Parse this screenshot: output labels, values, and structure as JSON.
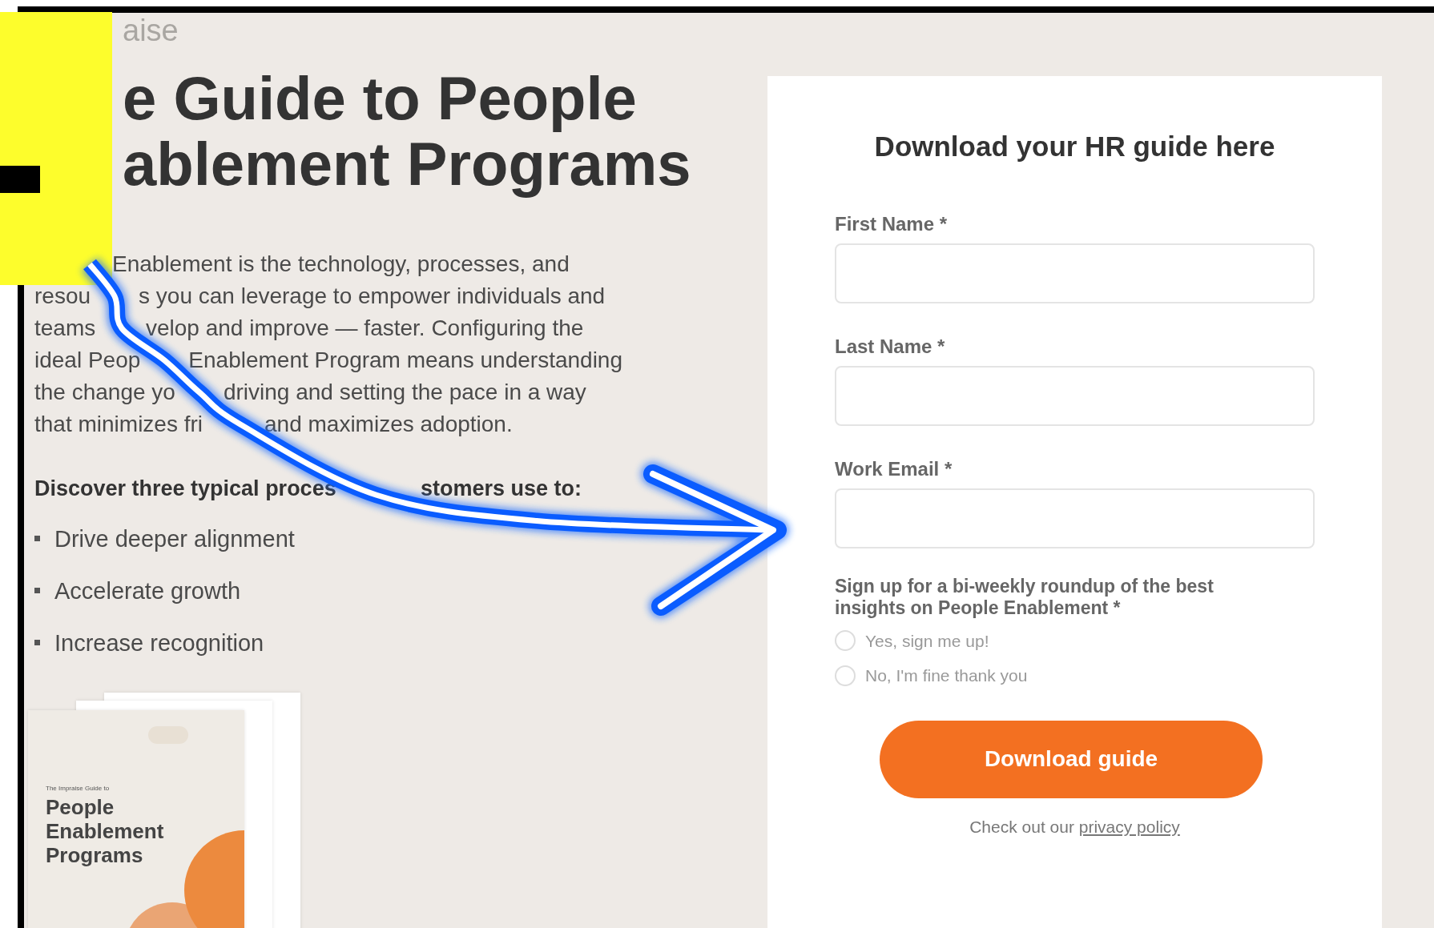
{
  "logo": "aise",
  "title_lines": [
    "e Guide to People",
    "ablement Programs"
  ],
  "intro_lines": [
    [
      "Enablement is the technology, processes, and"
    ],
    [
      "resou",
      "s you can leverage to empower individuals and"
    ],
    [
      "teams",
      "velop and improve — faster. Configuring the"
    ],
    [
      "ideal Peop",
      "Enablement Program means understanding"
    ],
    [
      "the change yo",
      "driving and setting the pace in a way"
    ],
    [
      "that minimizes fri",
      "and maximizes adoption."
    ]
  ],
  "discover_line": [
    "Discover three typical proces",
    "stomers use to:"
  ],
  "bullets": [
    "Drive deeper alignment",
    "Accelerate growth",
    "Increase recognition"
  ],
  "book": {
    "kicker": "The Impraise Guide to",
    "title_lines": [
      "People",
      "Enablement",
      "Programs"
    ]
  },
  "form": {
    "heading": "Download your HR guide here",
    "fields": [
      {
        "label": "First Name *"
      },
      {
        "label": "Last Name *"
      },
      {
        "label": "Work Email *"
      }
    ],
    "signup": {
      "question": "Sign up for a bi-weekly roundup of the best insights on People Enablement *",
      "options": [
        {
          "label": "Yes, sign me up!",
          "selected": false
        },
        {
          "label": "No, I'm fine thank you",
          "selected": false
        }
      ]
    },
    "button": "Download guide",
    "footer": {
      "text": "Check out our",
      "link": "privacy policy"
    }
  }
}
